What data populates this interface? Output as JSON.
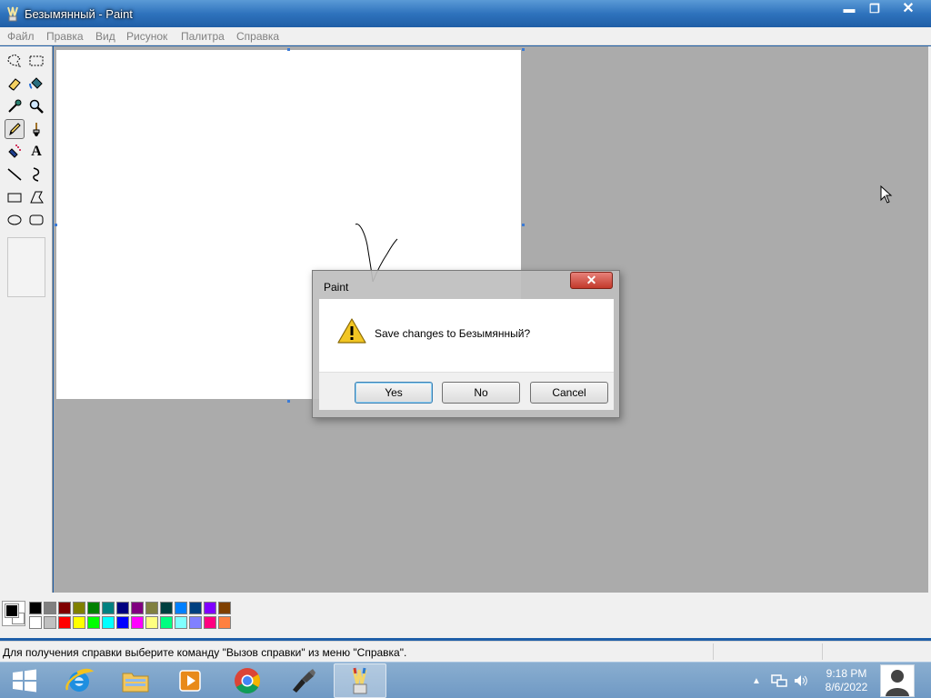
{
  "window": {
    "title": "Безымянный - Paint",
    "controls": {
      "minimize": "▬",
      "restore": "❐",
      "close": "✕"
    }
  },
  "menu": {
    "items": [
      "Файл",
      "Правка",
      "Вид",
      "Рисунок",
      "Палитра",
      "Справка"
    ]
  },
  "toolbox": {
    "tools": [
      "free-form-select-icon",
      "select-icon",
      "eraser-icon",
      "fill-icon",
      "pick-color-icon",
      "magnifier-icon",
      "pencil-icon",
      "brush-icon",
      "airbrush-icon",
      "text-icon",
      "line-icon",
      "curve-icon",
      "rectangle-icon",
      "polygon-icon",
      "ellipse-icon",
      "rounded-rectangle-icon"
    ],
    "active_tool": "pencil-icon",
    "text_tool_glyph": "A"
  },
  "palette": {
    "foreground": "#000000",
    "background": "#ffffff",
    "top_row": [
      "#000000",
      "#808080",
      "#800000",
      "#808000",
      "#008000",
      "#008080",
      "#000080",
      "#800080",
      "#808040",
      "#004040",
      "#0080ff",
      "#004080",
      "#8000ff",
      "#804000"
    ],
    "bottom_row": [
      "#ffffff",
      "#c0c0c0",
      "#ff0000",
      "#ffff00",
      "#00ff00",
      "#00ffff",
      "#0000ff",
      "#ff00ff",
      "#ffff80",
      "#00ff80",
      "#80ffff",
      "#8080ff",
      "#ff0080",
      "#ff8040"
    ]
  },
  "status": {
    "text": "Для получения справки выберите команду \"Вызов справки\" из меню \"Справка\"."
  },
  "dialog": {
    "title": "Paint",
    "close": "✕",
    "message": "Save changes to Безымянный?",
    "icon": "warning-icon",
    "buttons": {
      "yes": "Yes",
      "no": "No",
      "cancel": "Cancel"
    }
  },
  "taskbar": {
    "start": "windows-start-icon",
    "apps": [
      "internet-explorer-icon",
      "file-explorer-icon",
      "media-player-icon",
      "chrome-icon",
      "app-icon",
      "paint-icon"
    ],
    "tray": {
      "chevron": "▲"
    },
    "clock": {
      "time": "9:18 PM",
      "date": "8/6/2022"
    }
  }
}
